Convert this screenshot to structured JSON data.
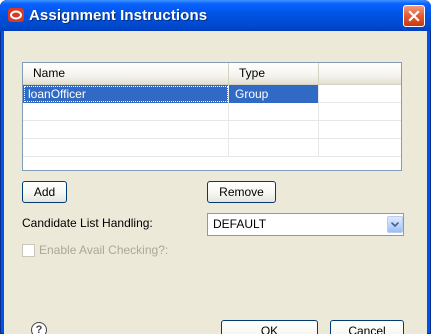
{
  "window": {
    "title": "Assignment Instructions",
    "icon": "oracle-app-icon",
    "close_icon": "close-icon"
  },
  "table": {
    "columns": [
      "Name",
      "Type",
      ""
    ],
    "rows": [
      {
        "name": "loanOfficer",
        "type": "Group",
        "selected": true
      },
      {
        "name": "",
        "type": "",
        "selected": false
      },
      {
        "name": "",
        "type": "",
        "selected": false
      },
      {
        "name": "",
        "type": "",
        "selected": false
      }
    ]
  },
  "actions": {
    "add_label": "Add",
    "remove_label": "Remove"
  },
  "candidate_list": {
    "label": "Candidate List Handling:",
    "value": "DEFAULT"
  },
  "avail_checking": {
    "label": "Enable Avail Checking?:",
    "checked": false,
    "enabled": false
  },
  "footer": {
    "help_icon": "help-icon",
    "help_symbol": "?",
    "ok_label": "OK",
    "cancel_label": "Cancel"
  },
  "colors": {
    "titlebar": "#0054e3",
    "selection": "#316ac5",
    "dialog_background": "#ece9d8",
    "close_button": "#e55f37"
  }
}
